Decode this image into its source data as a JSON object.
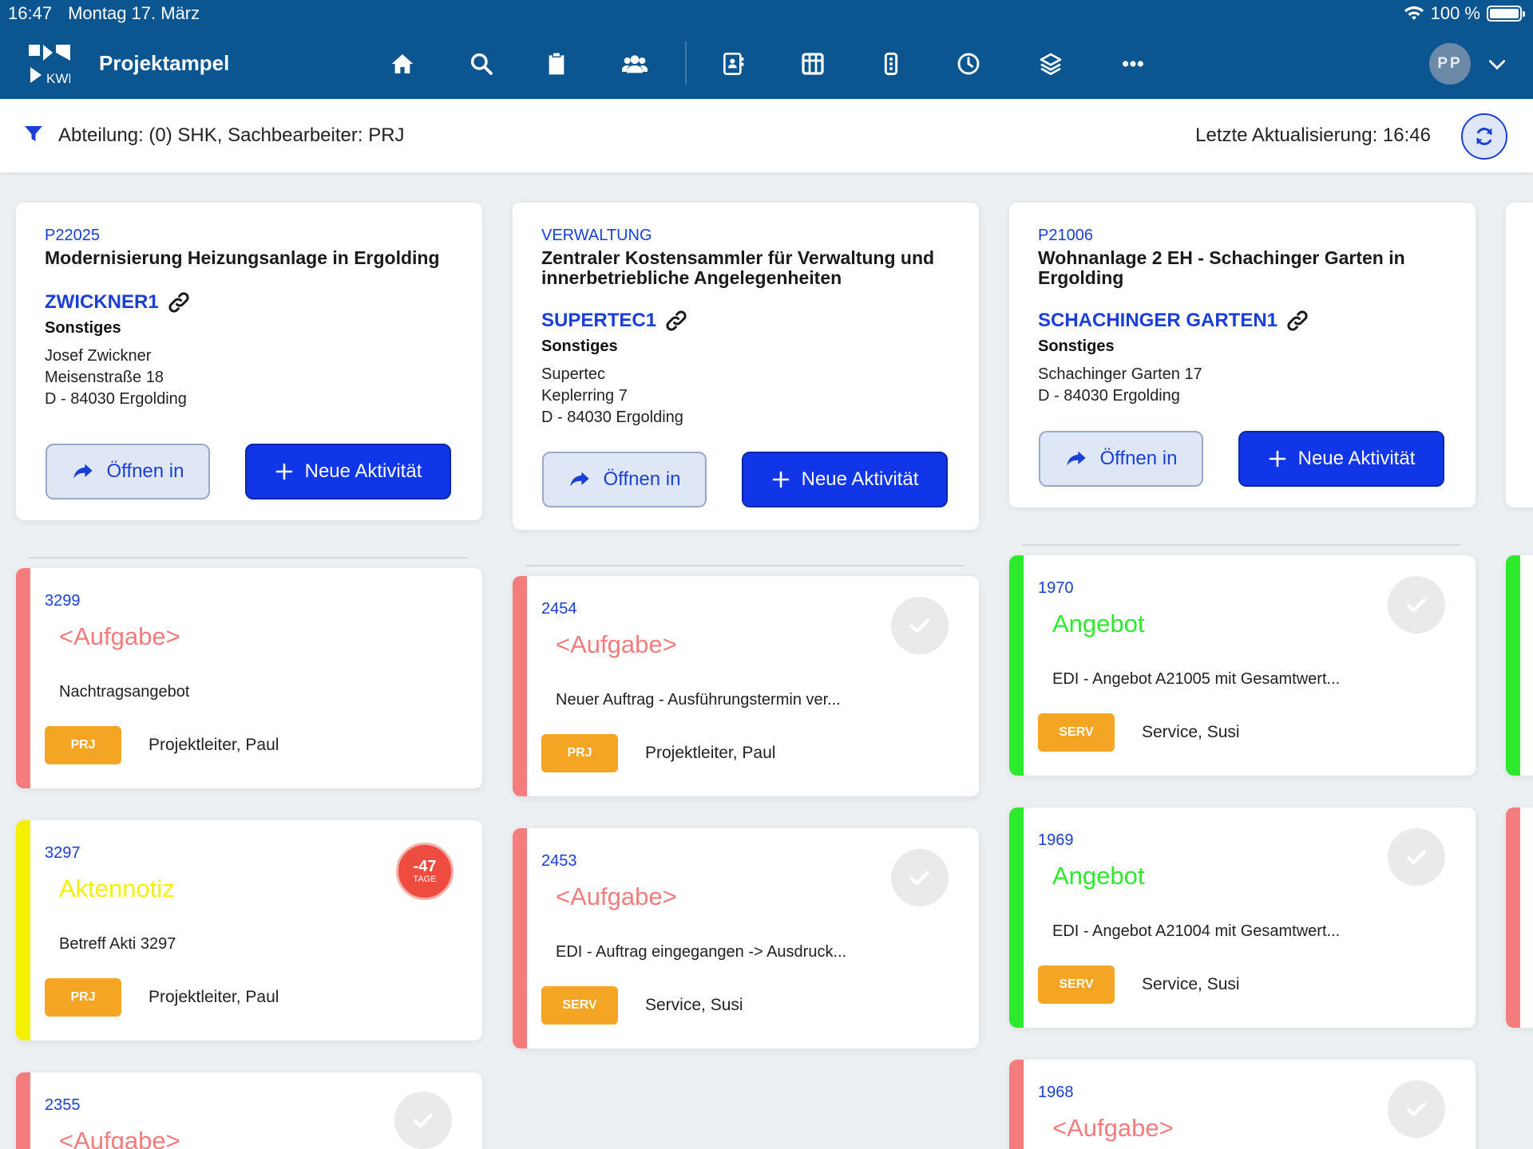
{
  "status_bar": {
    "time": "16:47",
    "date": "Montag 17. März",
    "battery": "100 %"
  },
  "app": {
    "title": "Projektampel"
  },
  "nav": {
    "icons": [
      "home-icon",
      "search-icon",
      "clipboard-icon",
      "people-icon",
      "contact-card-icon",
      "grid-icon",
      "traffic-light-icon",
      "clock-icon",
      "layers-icon",
      "more-icon"
    ]
  },
  "user": {
    "initials": "PP"
  },
  "filter": {
    "text": "Abteilung: (0) SHK, Sachbearbeiter: PRJ",
    "last_update": "Letzte Aktualisierung: 16:46"
  },
  "colors": {
    "brand": "#0b5591",
    "accent": "#1036e8",
    "red": "#f47c7c",
    "yellow": "#f5f000",
    "green": "#2dea2d",
    "badge": "#f5a524"
  },
  "buttons": {
    "open": "Öffnen in",
    "new_activity": "Neue Aktivität"
  },
  "columns": [
    {
      "project": {
        "code": "P22025",
        "title": "Modernisierung Heizungsanlage in Ergolding",
        "customer": "ZWICKNER1",
        "category": "Sonstiges",
        "address": [
          "Josef Zwickner",
          "Meisenstraße 18",
          "D - 84030 Ergolding"
        ]
      },
      "activities": [
        {
          "id": "3299",
          "type": "<Aufgabe>",
          "color": "#f47c7c",
          "text": "Nachtragsangebot",
          "badge": "PRJ",
          "person": "Projektleiter, Paul",
          "check": false
        },
        {
          "id": "3297",
          "type": "Aktennotiz",
          "color": "#f5f000",
          "text": "Betreff Akti 3297",
          "badge": "PRJ",
          "person": "Projektleiter, Paul",
          "check": false,
          "overdue": {
            "value": "-47",
            "unit": "TAGE"
          }
        },
        {
          "id": "2355",
          "type": "<Aufgabe>",
          "color": "#f47c7c",
          "text": "",
          "badge": "",
          "person": "",
          "check": true
        }
      ]
    },
    {
      "project": {
        "code": "VERWALTUNG",
        "title": "Zentraler Kostensammler für Verwaltung und innerbetriebliche Angelegenheiten",
        "customer": "SUPERTEC1",
        "category": "Sonstiges",
        "address": [
          "Supertec",
          "Keplerring 7",
          "D - 84030 Ergolding"
        ]
      },
      "activities": [
        {
          "id": "2454",
          "type": "<Aufgabe>",
          "color": "#f47c7c",
          "text": "Neuer Auftrag - Ausführungstermin ver...",
          "badge": "PRJ",
          "person": "Projektleiter, Paul",
          "check": true
        },
        {
          "id": "2453",
          "type": "<Aufgabe>",
          "color": "#f47c7c",
          "text": "EDI - Auftrag eingegangen -> Ausdruck...",
          "badge": "SERV",
          "person": "Service, Susi",
          "check": true
        }
      ]
    },
    {
      "project": {
        "code": "P21006",
        "title": "Wohnanlage 2 EH - Schachinger Garten in Ergolding",
        "customer": "SCHACHINGER GARTEN1",
        "category": "Sonstiges",
        "address": [
          "Schachinger Garten 17",
          "D - 84030 Ergolding"
        ]
      },
      "activities": [
        {
          "id": "1970",
          "type": "Angebot",
          "color": "#2dea2d",
          "text": "EDI - Angebot A21005 mit Gesamtwert...",
          "badge": "SERV",
          "person": "Service, Susi",
          "check": true
        },
        {
          "id": "1969",
          "type": "Angebot",
          "color": "#2dea2d",
          "text": "EDI - Angebot A21004 mit Gesamtwert...",
          "badge": "SERV",
          "person": "Service, Susi",
          "check": true
        },
        {
          "id": "1968",
          "type": "<Aufgabe>",
          "color": "#f47c7c",
          "text": "",
          "badge": "",
          "person": "",
          "check": true
        }
      ]
    }
  ]
}
